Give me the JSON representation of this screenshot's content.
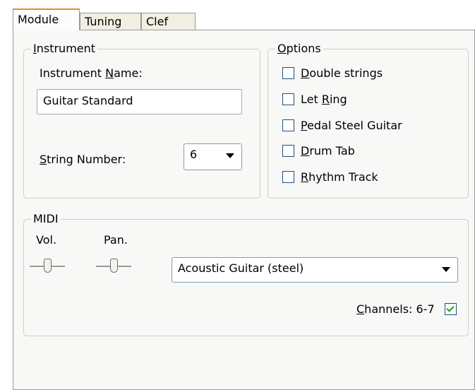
{
  "tabs": [
    {
      "label": "Module",
      "active": true
    },
    {
      "label": "Tuning",
      "active": false
    },
    {
      "label": "Clef",
      "active": false
    }
  ],
  "instrument": {
    "group_title_first": "I",
    "group_title_rest": "nstrument",
    "name_label_pre": "Instrument ",
    "name_label_underlined": "N",
    "name_label_post": "ame:",
    "name_value": "Guitar Standard",
    "string_label_underlined": "S",
    "string_label_rest": "tring Number:",
    "string_number_value": "6"
  },
  "options": {
    "group_title_first": "O",
    "group_title_rest": "ptions",
    "items": [
      {
        "pre": "",
        "u": "D",
        "post": "ouble strings",
        "checked": false
      },
      {
        "pre": "Let ",
        "u": "R",
        "post": "ing",
        "checked": false
      },
      {
        "pre": "",
        "u": "P",
        "post": "edal Steel Guitar",
        "checked": false
      },
      {
        "pre": "",
        "u": "D",
        "post": "rum Tab",
        "checked": false
      },
      {
        "pre": "",
        "u": "R",
        "post": "hythm Track",
        "checked": false
      }
    ]
  },
  "midi": {
    "group_title": "MIDI",
    "vol_label": "Vol.",
    "pan_label": "Pan.",
    "vol_level": 0.5,
    "pan_level": 0.5,
    "instrument_value": "Acoustic Guitar (steel)",
    "channels_underlined": "C",
    "channels_rest": "hannels: 6-7",
    "channels_checked": true
  },
  "colors": {
    "tab_active_accent": "#e68b2c",
    "checkmark": "#21a121"
  }
}
